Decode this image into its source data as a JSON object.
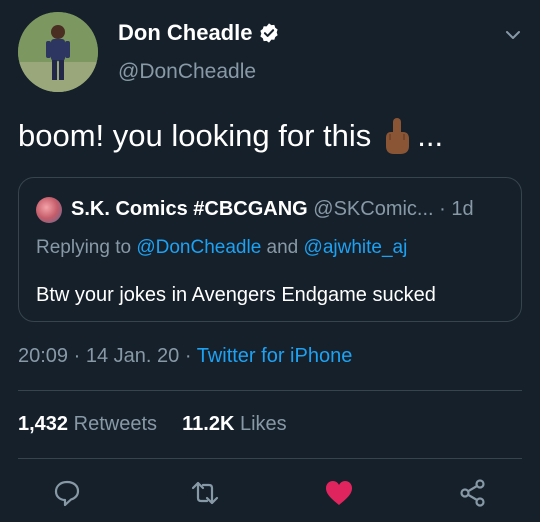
{
  "author": {
    "display_name": "Don Cheadle",
    "handle": "@DonCheadle",
    "verified": true
  },
  "tweet": {
    "text_before_emoji": "boom! you looking for this",
    "emoji": "middle-finger-emoji",
    "text_after_emoji": "..."
  },
  "quoted_tweet": {
    "display_name": "S.K. Comics #CBCGANG",
    "handle": "@SKComic...",
    "time_sep": " · ",
    "time": "1d",
    "replying_prefix": "Replying to ",
    "reply_user_1": "@DonCheadle",
    "reply_and": " and ",
    "reply_user_2": "@ajwhite_aj",
    "text": "Btw your jokes in Avengers Endgame sucked"
  },
  "meta": {
    "time": "20:09",
    "sep1": " · ",
    "date": "14 Jan. 20",
    "sep2": " · ",
    "source": "Twitter for iPhone"
  },
  "stats": {
    "retweets_count": "1,432",
    "retweets_label": "Retweets",
    "likes_count": "11.2K",
    "likes_label": "Likes"
  },
  "actions": [
    "reply-icon",
    "retweet-icon",
    "like-icon",
    "share-icon"
  ],
  "colors": {
    "background": "#15202b",
    "secondary_text": "#8899a6",
    "link": "#1da1f2",
    "like": "#e0245e",
    "border": "#38444d"
  }
}
